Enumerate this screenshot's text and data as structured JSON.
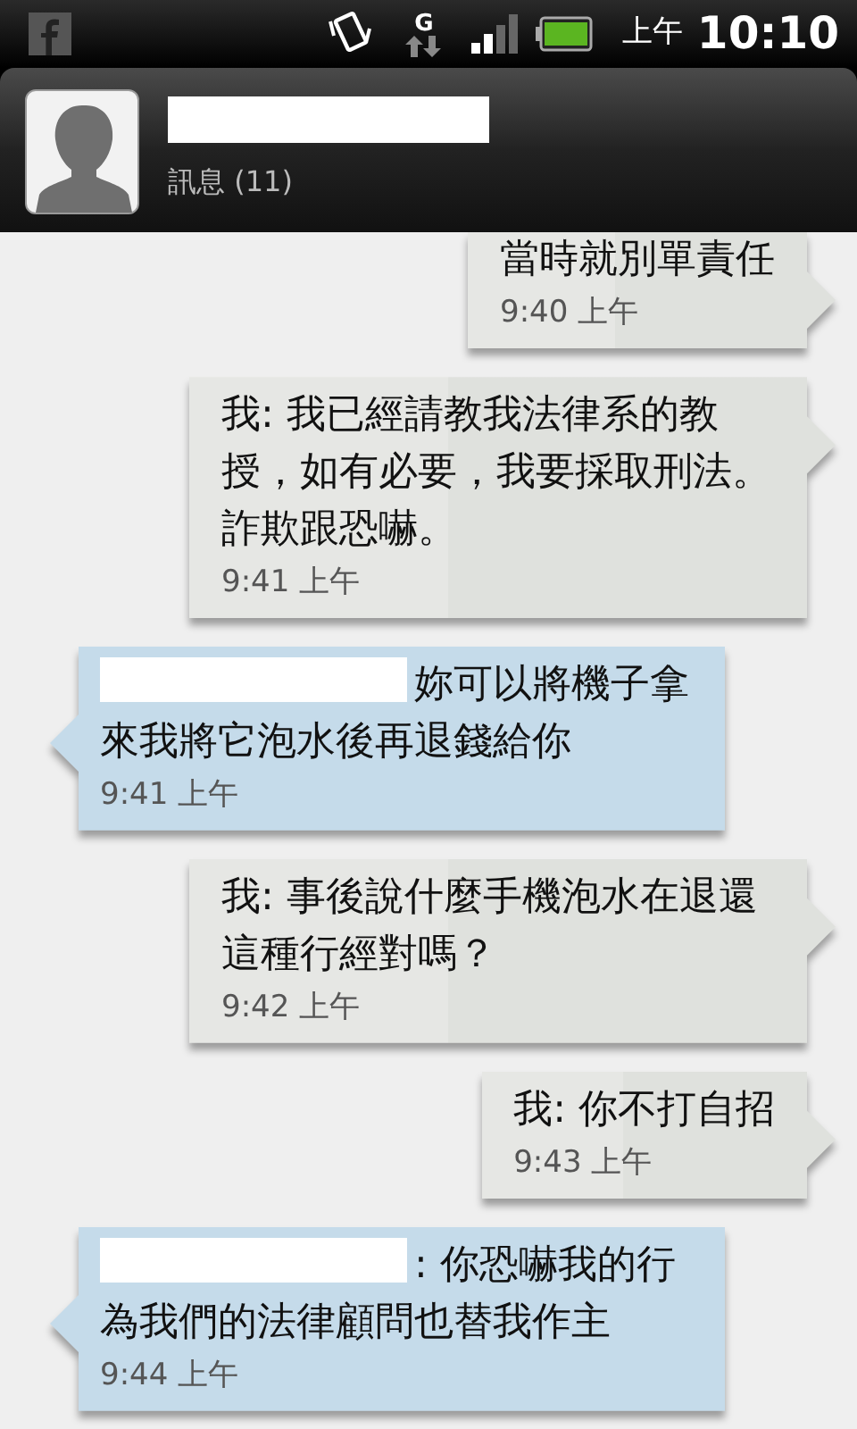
{
  "status_bar": {
    "period": "上午",
    "time": "10:10",
    "network": "G"
  },
  "header": {
    "subtitle": "訊息 (11)",
    "name_redacted": true
  },
  "messages": [
    {
      "kind": "sent",
      "text": "當時就別單責任",
      "time": "9:40 上午",
      "cut_top": true
    },
    {
      "kind": "sent",
      "text": "我: 我已經請教我法律系的教授，如有必要，我要採取刑法。詐欺跟恐嚇。",
      "time": "9:41 上午",
      "cut_top": false
    },
    {
      "kind": "received",
      "sender_redacted": true,
      "text": "妳可以將機子拿來我將它泡水後再退錢給你",
      "time": "9:41 上午"
    },
    {
      "kind": "sent",
      "text": "我: 事後說什麼手機泡水在退還這種行經對嗎？",
      "time": "9:42 上午",
      "cut_top": false
    },
    {
      "kind": "sent",
      "text": "我: 你不打自招",
      "time": "9:43 上午",
      "cut_top": false
    },
    {
      "kind": "received",
      "sender_redacted": true,
      "text": ": 你恐嚇我的行為我們的法律顧問也替我作主",
      "time": "9:44 上午"
    }
  ]
}
